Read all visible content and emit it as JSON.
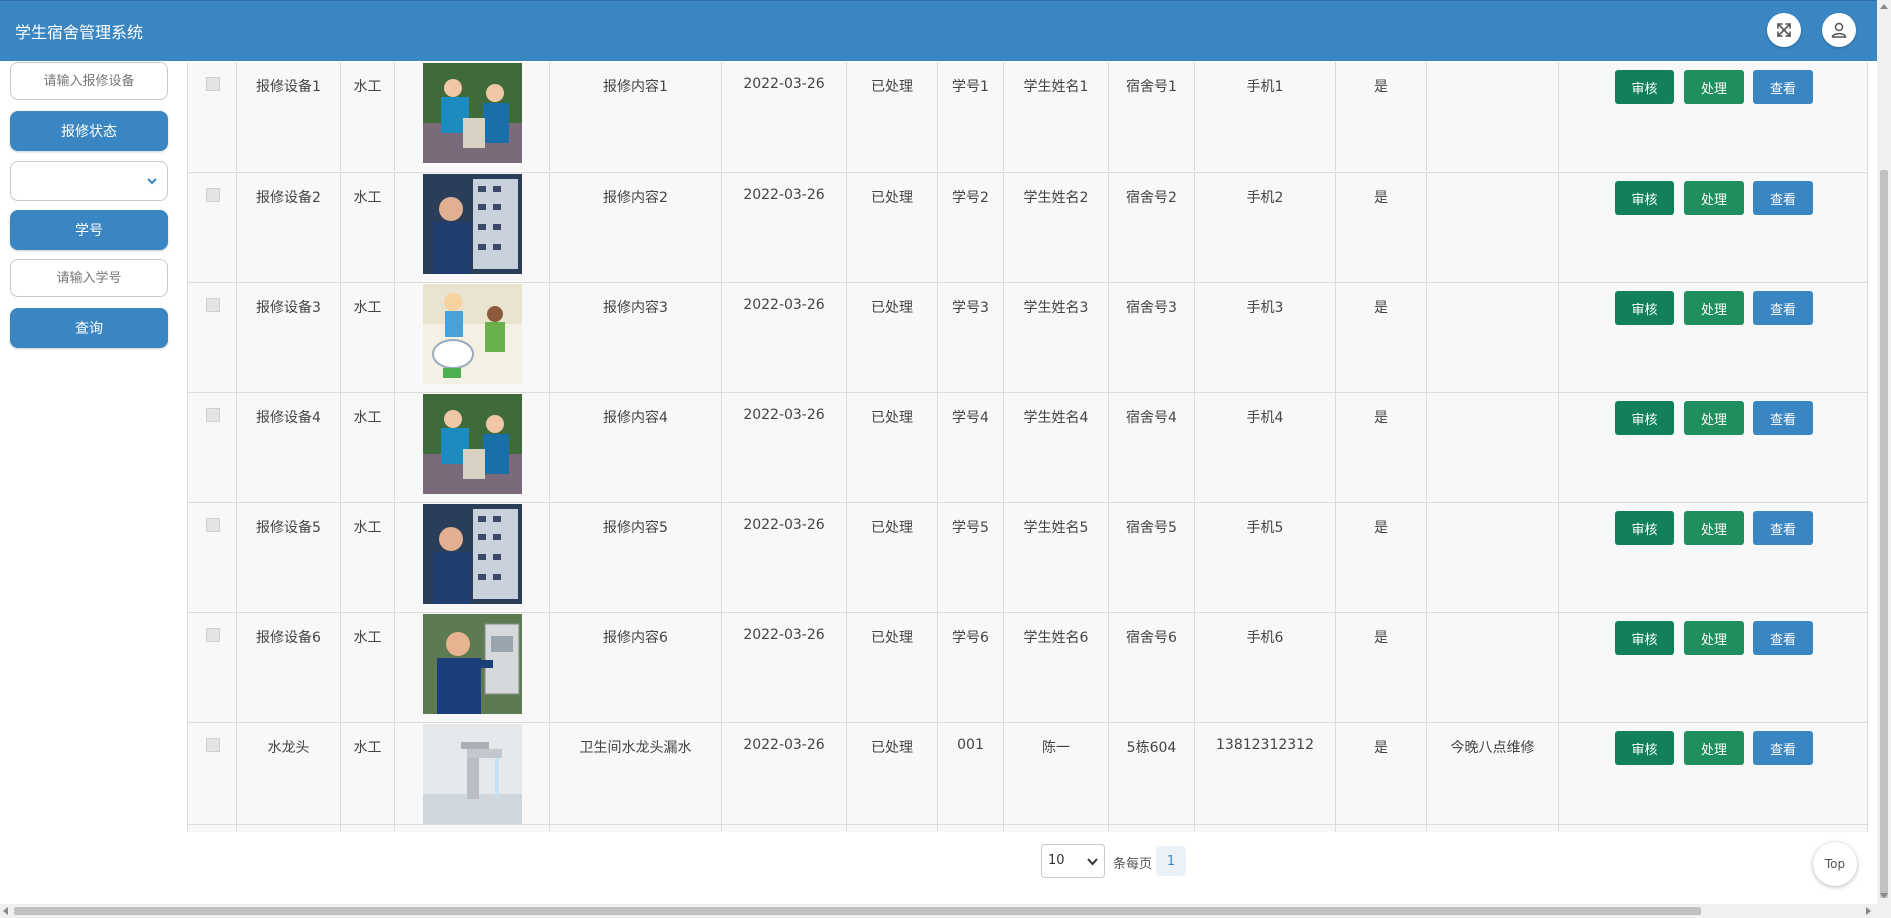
{
  "app": {
    "title": "学生宿舍管理系统",
    "fullscreen_icon": "fullscreen-icon",
    "user_icon": "user-icon"
  },
  "sidebar": {
    "equipment_placeholder": "请输入报修设备",
    "status_label": "报修状态",
    "status_value": "",
    "student_no_label": "学号",
    "student_no_placeholder": "请输入学号",
    "search_label": "查询"
  },
  "actions": {
    "audit": "审核",
    "process": "处理",
    "view": "查看"
  },
  "rows": [
    {
      "equipment": "报修设备1",
      "type": "水工",
      "image": "worker-outdoor-photo",
      "content": "报修内容1",
      "date": "2022-03-26",
      "status": "已处理",
      "student_no": "学号1",
      "student_name": "学生姓名1",
      "dorm": "宿舍号1",
      "phone": "手机1",
      "flag": "是",
      "note": ""
    },
    {
      "equipment": "报修设备2",
      "type": "水工",
      "image": "electric-panel-photo",
      "content": "报修内容2",
      "date": "2022-03-26",
      "status": "已处理",
      "student_no": "学号2",
      "student_name": "学生姓名2",
      "dorm": "宿舍号2",
      "phone": "手机2",
      "flag": "是",
      "note": ""
    },
    {
      "equipment": "报修设备3",
      "type": "水工",
      "image": "plumber-cartoon",
      "content": "报修内容3",
      "date": "2022-03-26",
      "status": "已处理",
      "student_no": "学号3",
      "student_name": "学生姓名3",
      "dorm": "宿舍号3",
      "phone": "手机3",
      "flag": "是",
      "note": ""
    },
    {
      "equipment": "报修设备4",
      "type": "水工",
      "image": "worker-outdoor-photo",
      "content": "报修内容4",
      "date": "2022-03-26",
      "status": "已处理",
      "student_no": "学号4",
      "student_name": "学生姓名4",
      "dorm": "宿舍号4",
      "phone": "手机4",
      "flag": "是",
      "note": ""
    },
    {
      "equipment": "报修设备5",
      "type": "水工",
      "image": "electric-panel-photo",
      "content": "报修内容5",
      "date": "2022-03-26",
      "status": "已处理",
      "student_no": "学号5",
      "student_name": "学生姓名5",
      "dorm": "宿舍号5",
      "phone": "手机5",
      "flag": "是",
      "note": ""
    },
    {
      "equipment": "报修设备6",
      "type": "水工",
      "image": "wall-box-repair-photo",
      "content": "报修内容6",
      "date": "2022-03-26",
      "status": "已处理",
      "student_no": "学号6",
      "student_name": "学生姓名6",
      "dorm": "宿舍号6",
      "phone": "手机6",
      "flag": "是",
      "note": ""
    },
    {
      "equipment": "水龙头",
      "type": "水工",
      "image": "faucet-photo",
      "content": "卫生间水龙头漏水",
      "date": "2022-03-26",
      "status": "已处理",
      "student_no": "001",
      "student_name": "陈一",
      "dorm": "5栋604",
      "phone": "13812312312",
      "flag": "是",
      "note": "今晚八点维修"
    }
  ],
  "pagination": {
    "page_size": "10",
    "per_page_label": "条每页",
    "current_page": "1"
  },
  "top_button": "Top",
  "colors": {
    "primary": "#3a86c3",
    "audit": "#13805c",
    "process": "#1f8f5d",
    "row_bg": "#f8f8f8"
  }
}
